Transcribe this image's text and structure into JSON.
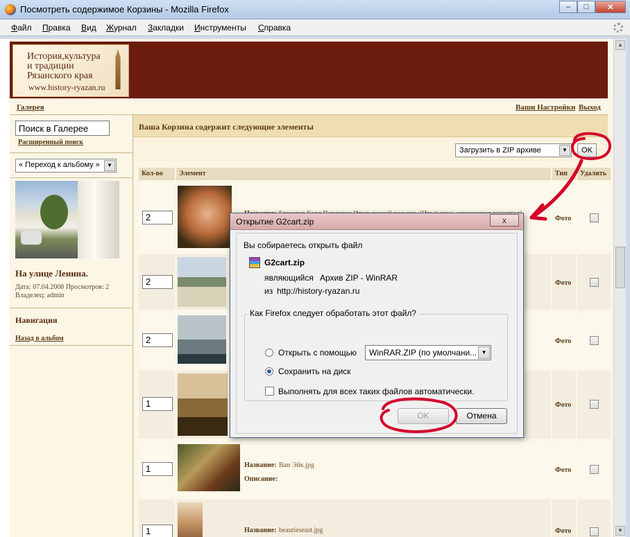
{
  "window": {
    "title": "Посмотреть содержимое Корзины - Mozilla Firefox"
  },
  "menu": [
    "Файл",
    "Правка",
    "Вид",
    "Журнал",
    "Закладки",
    "Инструменты",
    "Справка"
  ],
  "site": {
    "logo_lines": [
      "История,культура",
      "и традиции",
      "Рязанского края",
      "www.history-ryazan.ru"
    ],
    "breadcrumb": "Галерея",
    "user_links": [
      "Ваши Настройки",
      "Выход"
    ]
  },
  "sidebar": {
    "search_value": "Поиск в Галерее",
    "advanced_search": "Расширенный поиск",
    "album_jump": "« Переход к альбому »",
    "photo_caption": "На улице Ленина.",
    "photo_meta": "Дата: 07.04.2008 Просмотров: 2",
    "photo_owner": "Владелец: admin",
    "nav_title": "Навигация",
    "back_link": "Назад в альбом"
  },
  "cart": {
    "heading": "Ваша Корзина содержит следующие элементы",
    "zip_option": "Загрузить в ZIP архиве",
    "ok_label": "OK",
    "columns": [
      "Кол-во",
      "Элемент",
      "Тип",
      "Удалить"
    ],
    "rows": [
      {
        "qty": "2",
        "name_label": "Название:",
        "name": "Брюллов Карл Павлович Итальянский полдень (Итальянка, снимающая виноград)",
        "desc_label": "",
        "type": "Фото"
      },
      {
        "qty": "2",
        "name_label": "",
        "name": "",
        "desc_label": "",
        "type": "Фото"
      },
      {
        "qty": "2",
        "name_label": "",
        "name": "",
        "desc_label": "",
        "type": "Фото"
      },
      {
        "qty": "1",
        "name_label": "",
        "name": "",
        "desc_label": "",
        "type": "Фото"
      },
      {
        "qty": "1",
        "name_label": "Название:",
        "name": "Ван Эйк.jpg",
        "desc_label": "Описание:",
        "type": "Фото"
      },
      {
        "qty": "1",
        "name_label": "Название:",
        "name": "beautieseast.jpg",
        "desc_label": "",
        "type": "Фото"
      }
    ]
  },
  "dialog": {
    "title": "Открытие G2cart.zip",
    "close_label": "x",
    "intro": "Вы собираетесь открыть файл",
    "filename": "G2cart.zip",
    "type_prefix": "являющийся",
    "type": "Архив ZIP - WinRAR",
    "from_prefix": "из",
    "from": "http://history-ryazan.ru",
    "group_label": "Как Firefox следует обработать этот файл?",
    "open_with": "Открыть с помощью",
    "app": "WinRAR.ZIP (по умолчани...",
    "save": "Сохранить на диск",
    "auto": "Выполнять для всех таких файлов автоматически.",
    "ok": "OK",
    "cancel": "Отмена"
  },
  "colors": {
    "header": "#6b1c0e",
    "annotation": "#d4002a",
    "page_bg": "#fbf6e6"
  }
}
